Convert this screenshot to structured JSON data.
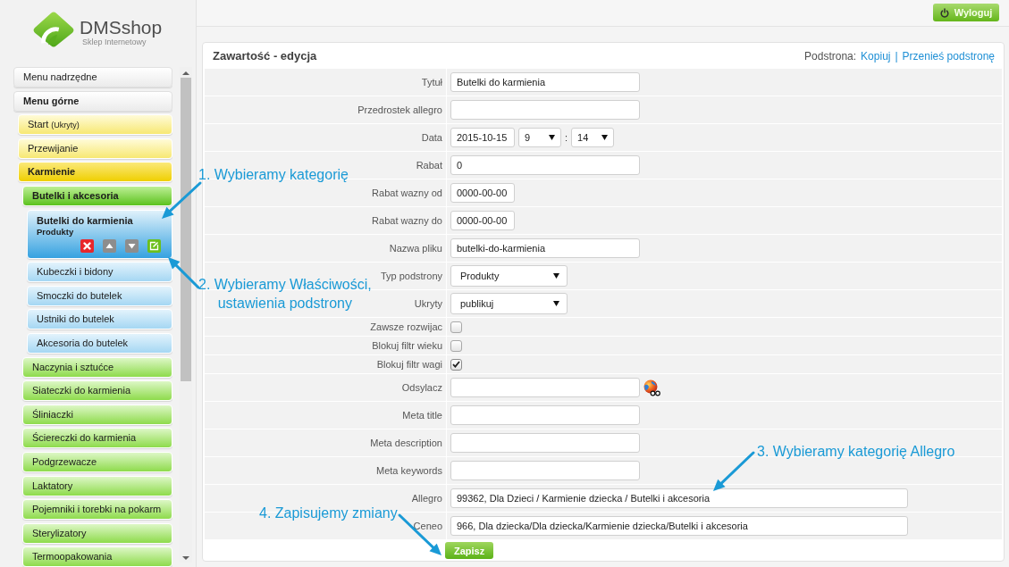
{
  "logo": {
    "name": "DMSshop",
    "tagline": "Sklep Internetowy"
  },
  "sidebar": {
    "menu": [
      {
        "label": "Menu nadrzędne",
        "expanded": false,
        "selected": false
      },
      {
        "label": "Menu górne",
        "expanded": true,
        "selected": false,
        "children": [
          {
            "label": "Start",
            "note": "(Ukryty)",
            "expanded": false,
            "selected": false
          },
          {
            "label": "Przewijanie",
            "expanded": false,
            "selected": false
          },
          {
            "label": "Karmienie",
            "expanded": true,
            "selected": false,
            "children": [
              {
                "label": "Butelki i akcesoria",
                "expanded": true,
                "selected": false,
                "children": [
                  {
                    "label": "Butelki do karmienia",
                    "subtitle": "Produkty",
                    "expanded": false,
                    "selected": true
                  },
                  {
                    "label": "Kubeczki i bidony",
                    "expanded": false,
                    "selected": false
                  },
                  {
                    "label": "Smoczki do butelek",
                    "expanded": false,
                    "selected": false
                  },
                  {
                    "label": "Ustniki do butelek",
                    "expanded": false,
                    "selected": false
                  },
                  {
                    "label": "Akcesoria do butelek",
                    "expanded": false,
                    "selected": false
                  }
                ]
              },
              {
                "label": "Naczynia i sztućce",
                "expanded": false,
                "selected": false
              },
              {
                "label": "Siateczki do karmienia",
                "expanded": false,
                "selected": false
              },
              {
                "label": "Śliniaczki",
                "expanded": false,
                "selected": false
              },
              {
                "label": "Ściereczki do karmienia",
                "expanded": false,
                "selected": false
              },
              {
                "label": "Podgrzewacze",
                "expanded": false,
                "selected": false
              },
              {
                "label": "Laktatory",
                "expanded": false,
                "selected": false
              },
              {
                "label": "Pojemniki i torebki na pokarm",
                "expanded": false,
                "selected": false
              },
              {
                "label": "Sterylizatory",
                "expanded": false,
                "selected": false
              },
              {
                "label": "Termoopakowania",
                "expanded": false,
                "selected": false
              }
            ]
          }
        ]
      }
    ]
  },
  "header": {
    "logout": "Wyloguj"
  },
  "panel": {
    "title": "Zawartość - edycja",
    "subpage_label": "Podstrona:",
    "links": [
      "Kopiuj",
      "Przenieś podstronę"
    ],
    "link_separator": "|",
    "rows": [
      {
        "label": "Tytuł",
        "kind": "text",
        "value": "Butelki do karmienia"
      },
      {
        "label": "Przedrostek allegro",
        "kind": "text"
      },
      {
        "label": "Data",
        "kind": "datetime",
        "date": "2015-10-15",
        "hour": "9",
        "separator": ":",
        "minute": "14"
      },
      {
        "label": "Rabat",
        "kind": "text",
        "value": "0"
      },
      {
        "label": "Rabat wazny od",
        "kind": "date",
        "value": "0000-00-00"
      },
      {
        "label": "Rabat wazny do",
        "kind": "date",
        "value": "0000-00-00"
      },
      {
        "label": "Nazwa pliku",
        "kind": "text",
        "value": "butelki-do-karmienia"
      },
      {
        "label": "Typ podstrony",
        "kind": "select",
        "value": "Produkty"
      },
      {
        "label": "Ukryty",
        "kind": "select",
        "value": "publikuj"
      },
      {
        "label": "Zawsze rozwijac",
        "kind": "checkbox",
        "checked": false
      },
      {
        "label": "Blokuj filtr wieku",
        "kind": "checkbox",
        "checked": false
      },
      {
        "label": "Blokuj filtr wagi",
        "kind": "checkbox",
        "checked": true
      },
      {
        "label": "Odsylacz",
        "kind": "url"
      },
      {
        "label": "Meta title",
        "kind": "text"
      },
      {
        "label": "Meta description",
        "kind": "text"
      },
      {
        "label": "Meta keywords",
        "kind": "text"
      },
      {
        "label": "Allegro",
        "kind": "category",
        "value": "99362, Dla Dzieci / Karmienie dziecka / Butelki i akcesoria"
      },
      {
        "label": "Ceneo",
        "kind": "category",
        "value": "966, Dla dziecka/Dla dziecka/Karmienie dziecka/Butelki i akcesoria"
      }
    ],
    "save_button": "Zapisz"
  },
  "annotations": [
    {
      "lines": [
        "1. Wybieramy kategorię"
      ]
    },
    {
      "lines": [
        "2. Wybieramy Właściwości,",
        "ustawienia podstrony"
      ]
    },
    {
      "lines": [
        "3. Wybieramy kategorię Allegro"
      ]
    },
    {
      "lines": [
        "4. Zapisujemy zmiany"
      ]
    }
  ]
}
